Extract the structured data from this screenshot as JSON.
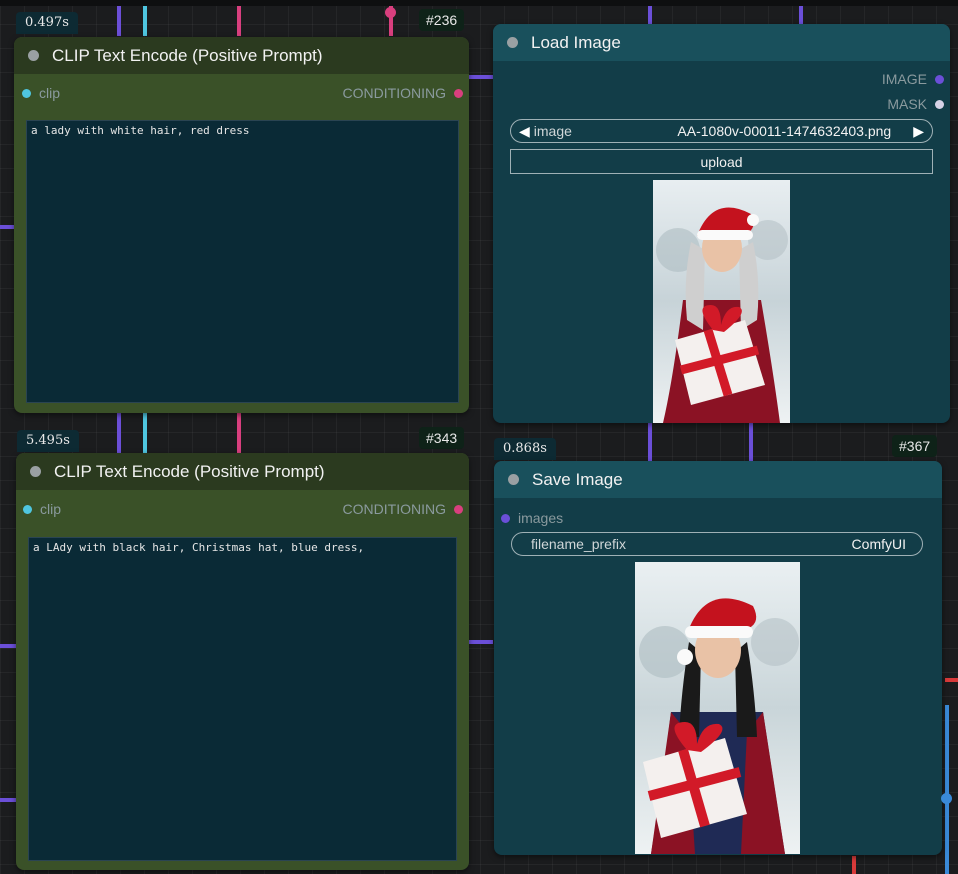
{
  "canvas": {
    "background": "#1b1c1e",
    "link_colors": {
      "purple": "#6b4fd8",
      "cyan": "#4fc6e0",
      "pink": "#d93f7e",
      "red": "#d83a3a",
      "blue": "#3a8ad8"
    }
  },
  "nodes": {
    "clip1": {
      "time": "0.497s",
      "id": "#236",
      "title": "CLIP Text Encode (Positive Prompt)",
      "input_label": "clip",
      "output_label": "CONDITIONING",
      "text": "a lady with white hair, red dress"
    },
    "clip2": {
      "time": "5.495s",
      "id": "#343",
      "title": "CLIP Text Encode (Positive Prompt)",
      "input_label": "clip",
      "output_label": "CONDITIONING",
      "text": "a LAdy with black hair, Christmas hat, blue dress,"
    },
    "load": {
      "title": "Load Image",
      "outputs": [
        "IMAGE",
        "MASK"
      ],
      "image_label": "image",
      "image_value": "AA-1080v-00011-1474632403.png",
      "upload_label": "upload",
      "preview_icon": "photo-preview-woman-red-dress"
    },
    "save": {
      "time": "0.868s",
      "id": "#367",
      "title": "Save Image",
      "input_label": "images",
      "prefix_label": "filename_prefix",
      "prefix_value": "ComfyUI",
      "preview_icon": "photo-preview-woman-blue-dress"
    }
  },
  "icons": {
    "arrow_left": "◀",
    "arrow_right": "▶"
  }
}
